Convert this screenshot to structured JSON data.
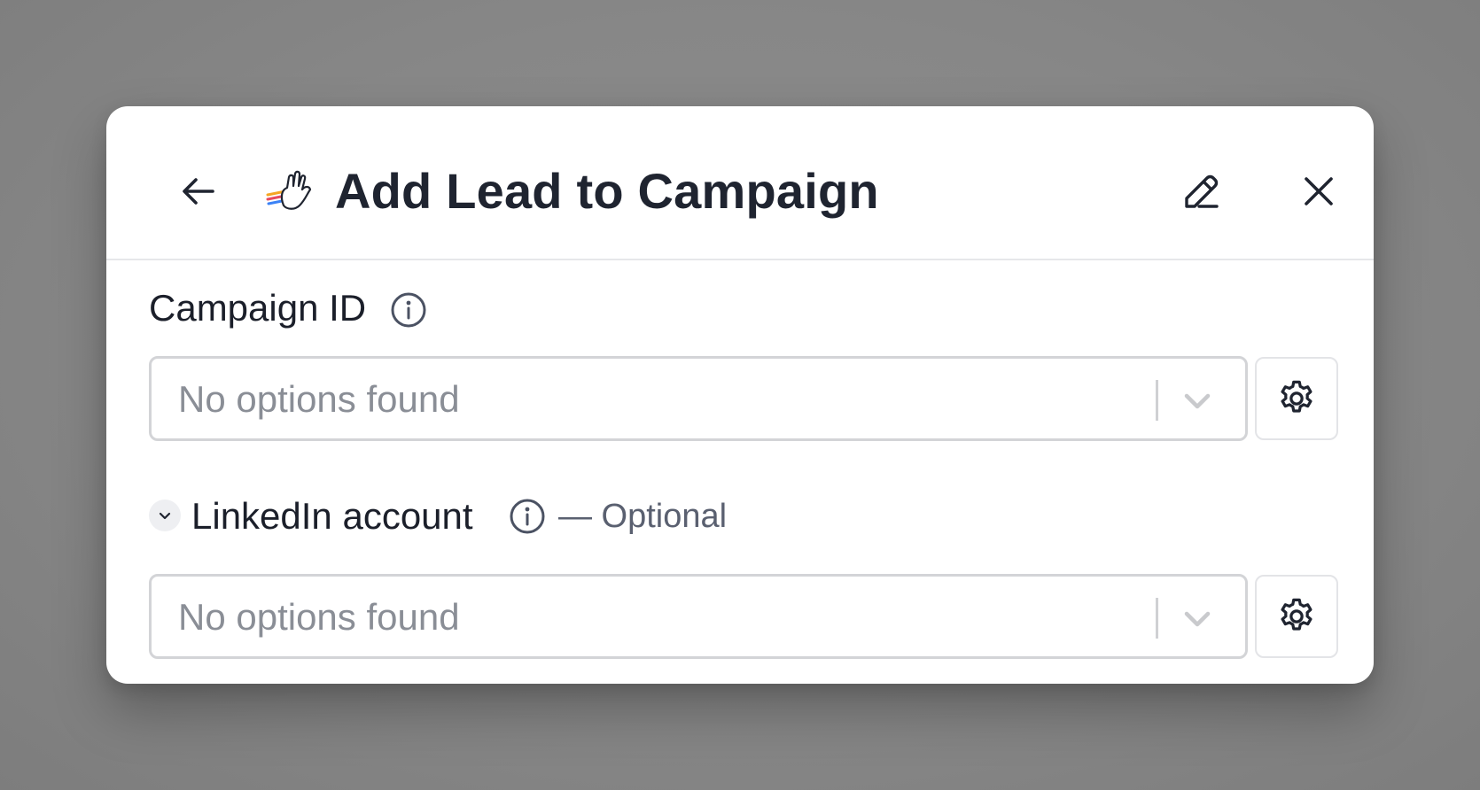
{
  "dialog": {
    "title": "Add Lead to Campaign",
    "app_icon": "waving-hand-logo"
  },
  "header": {
    "back_icon": "arrow-left-icon",
    "edit_icon": "pencil-icon",
    "close_icon": "close-icon"
  },
  "fields": [
    {
      "label": "Campaign ID",
      "info_icon": "info-icon",
      "optional": "",
      "select_placeholder": "No options found",
      "settings_icon": "gear-icon"
    },
    {
      "label": "LinkedIn account",
      "info_icon": "info-icon",
      "optional": "— Optional",
      "collapsed_icon": "chevron-down-icon",
      "select_placeholder": "No options found",
      "settings_icon": "gear-icon"
    }
  ],
  "colors": {
    "backdrop": "#878787",
    "title_text": "#1f2430",
    "placeholder_text": "#8a8e96",
    "border": "#d3d4d7"
  }
}
